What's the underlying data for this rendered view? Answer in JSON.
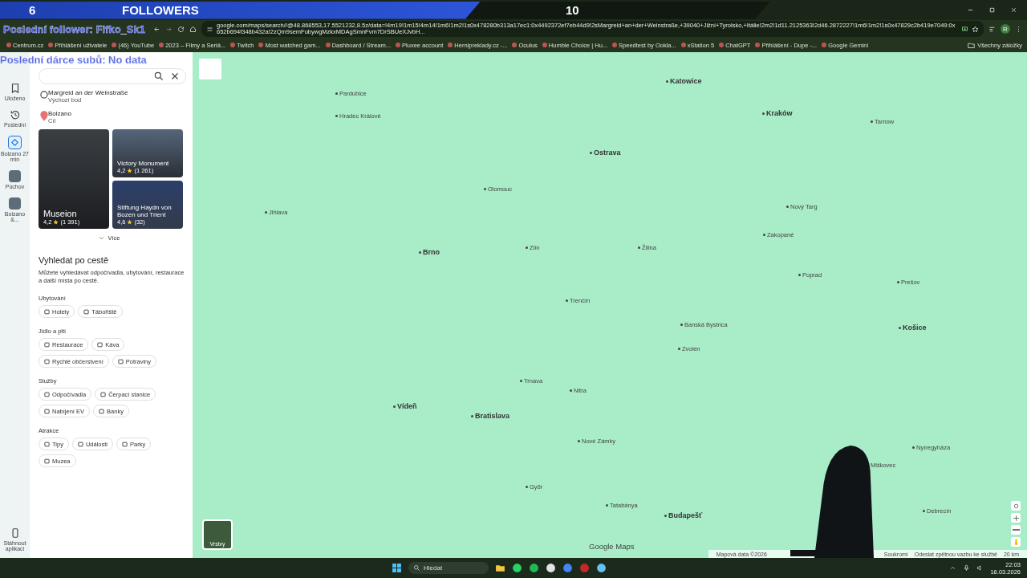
{
  "overlay": {
    "followers_current": "6",
    "followers_label": "FOLLOWERS",
    "followers_goal": "10",
    "last_follower": "Poslední follower: Fifko_Sk1",
    "last_donor": "Poslední dárce subů: No data"
  },
  "browser": {
    "url": "google.com/maps/search//@48.868553,17.5521232,8.5z/data=!4m19!1m15!4m14!1m6!1m2!1s0x478280b313a17ec1:0x4492372ef7eb44d9!2sMargreid+an+der+Weinstraße,+39040+Jižní+Tyrolsko,+Itálie!2m2!1d11.2125363!2d46.2872227!1m6!1m2!1s0x47829c2b419e7049:0x652b694f348b432a!2zQm9semFubywgMzkxMDAgSmnFvm7DrSBUeXJvbH...",
    "profile": "R",
    "bookmarks": [
      {
        "label": "Centrum.cz"
      },
      {
        "label": "Přihlášení uživatele"
      },
      {
        "label": "(46) YouTube"
      },
      {
        "label": "2023 – Filmy a Seriá..."
      },
      {
        "label": "Twitch"
      },
      {
        "label": "Most watched gam..."
      },
      {
        "label": "Dashboard / Stream..."
      },
      {
        "label": "Pluxee account"
      },
      {
        "label": "Hernipreklady.cz -..."
      },
      {
        "label": "Oculus"
      },
      {
        "label": "Humble Choice | Hu..."
      },
      {
        "label": "Speedtest by Ookla..."
      },
      {
        "label": "xStation 5"
      },
      {
        "label": "ChatGPT"
      },
      {
        "label": "Přihlášení - Dupe -..."
      },
      {
        "label": "Google Gemini"
      }
    ],
    "all_bookmarks": "Všechny záložky"
  },
  "rail": {
    "items": [
      {
        "label": "Uloženo",
        "kind": "saved"
      },
      {
        "label": "Poslední",
        "kind": "history"
      },
      {
        "label": "Bolzano 27 min",
        "kind": "route"
      },
      {
        "label": "Púchov",
        "kind": "thumb"
      },
      {
        "label": "Bolzano &...",
        "kind": "thumb"
      }
    ],
    "download": "Stáhnout aplikaci"
  },
  "panel": {
    "route": [
      {
        "name": "Margreid an der Weinstraße",
        "role": "Výchozí bod",
        "kind": "start"
      },
      {
        "name": "Bolzano",
        "role": "Cíl",
        "kind": "end"
      }
    ],
    "places": [
      {
        "name": "Museion",
        "rating": "4,2",
        "reviews": "(1 391)"
      },
      {
        "name": "Victory Monument",
        "rating": "4,2",
        "reviews": "(1 261)"
      },
      {
        "name": "Stiftung Haydn von Bozen und Trient",
        "rating": "4,6",
        "reviews": "(32)"
      }
    ],
    "more": "Více",
    "heading": "Vyhledat po cestě",
    "description": "Můžete vyhledávat odpočívadla, ubytování, restaurace a další místa po cestě.",
    "sections": [
      {
        "title": "Ubytování",
        "chips": [
          "Hotely",
          "Tábořiště"
        ]
      },
      {
        "title": "Jídlo a pití",
        "chips": [
          "Restaurace",
          "Káva",
          "Rychlé občerstvení",
          "Potraviny"
        ]
      },
      {
        "title": "Služby",
        "chips": [
          "Odpočívadla",
          "Čerpací stanice",
          "Nabíjení EV",
          "Banky"
        ]
      },
      {
        "title": "Atrakce",
        "chips": [
          "Tipy",
          "Události",
          "Parky",
          "Muzea"
        ]
      }
    ]
  },
  "map": {
    "labels": [
      {
        "text": "Katowice",
        "kind": "city"
      },
      {
        "text": "Pardubice",
        "kind": "town"
      },
      {
        "text": "Kraków",
        "kind": "city"
      },
      {
        "text": "Hradec Králové",
        "kind": "town"
      },
      {
        "text": "Tarnów",
        "kind": "town"
      },
      {
        "text": "Ostrava",
        "kind": "city"
      },
      {
        "text": "Olomouc",
        "kind": "town"
      },
      {
        "text": "Nový Targ",
        "kind": "town"
      },
      {
        "text": "Jihlava",
        "kind": "town"
      },
      {
        "text": "Zakopané",
        "kind": "town"
      },
      {
        "text": "Zlín",
        "kind": "town"
      },
      {
        "text": "Žilina",
        "kind": "town"
      },
      {
        "text": "Brno",
        "kind": "city"
      },
      {
        "text": "Poprad",
        "kind": "town"
      },
      {
        "text": "Prešov",
        "kind": "town"
      },
      {
        "text": "Trenčín",
        "kind": "town"
      },
      {
        "text": "Banská Bystrica",
        "kind": "town"
      },
      {
        "text": "Košice",
        "kind": "city"
      },
      {
        "text": "Zvolen",
        "kind": "town"
      },
      {
        "text": "Trnava",
        "kind": "town"
      },
      {
        "text": "Nitra",
        "kind": "town"
      },
      {
        "text": "Vídeň",
        "kind": "city"
      },
      {
        "text": "Bratislava",
        "kind": "city"
      },
      {
        "text": "Nové Zámky",
        "kind": "town"
      },
      {
        "text": "Nyíregyháza",
        "kind": "town"
      },
      {
        "text": "Miškovec",
        "kind": "town"
      },
      {
        "text": "Győr",
        "kind": "town"
      },
      {
        "text": "Tatabánya",
        "kind": "town"
      },
      {
        "text": "Debrecín",
        "kind": "town"
      },
      {
        "text": "Budapešť",
        "kind": "city"
      }
    ],
    "layers": "Vrstvy",
    "brand": "Google Maps",
    "footer": [
      "Mapová data ©2026",
      "Soukromí",
      "Odeslat zpětnou vazbu ke službě",
      "20 km"
    ]
  },
  "taskbar": {
    "search": "Hledat",
    "time": "22:03",
    "date": "16.03.2026"
  }
}
